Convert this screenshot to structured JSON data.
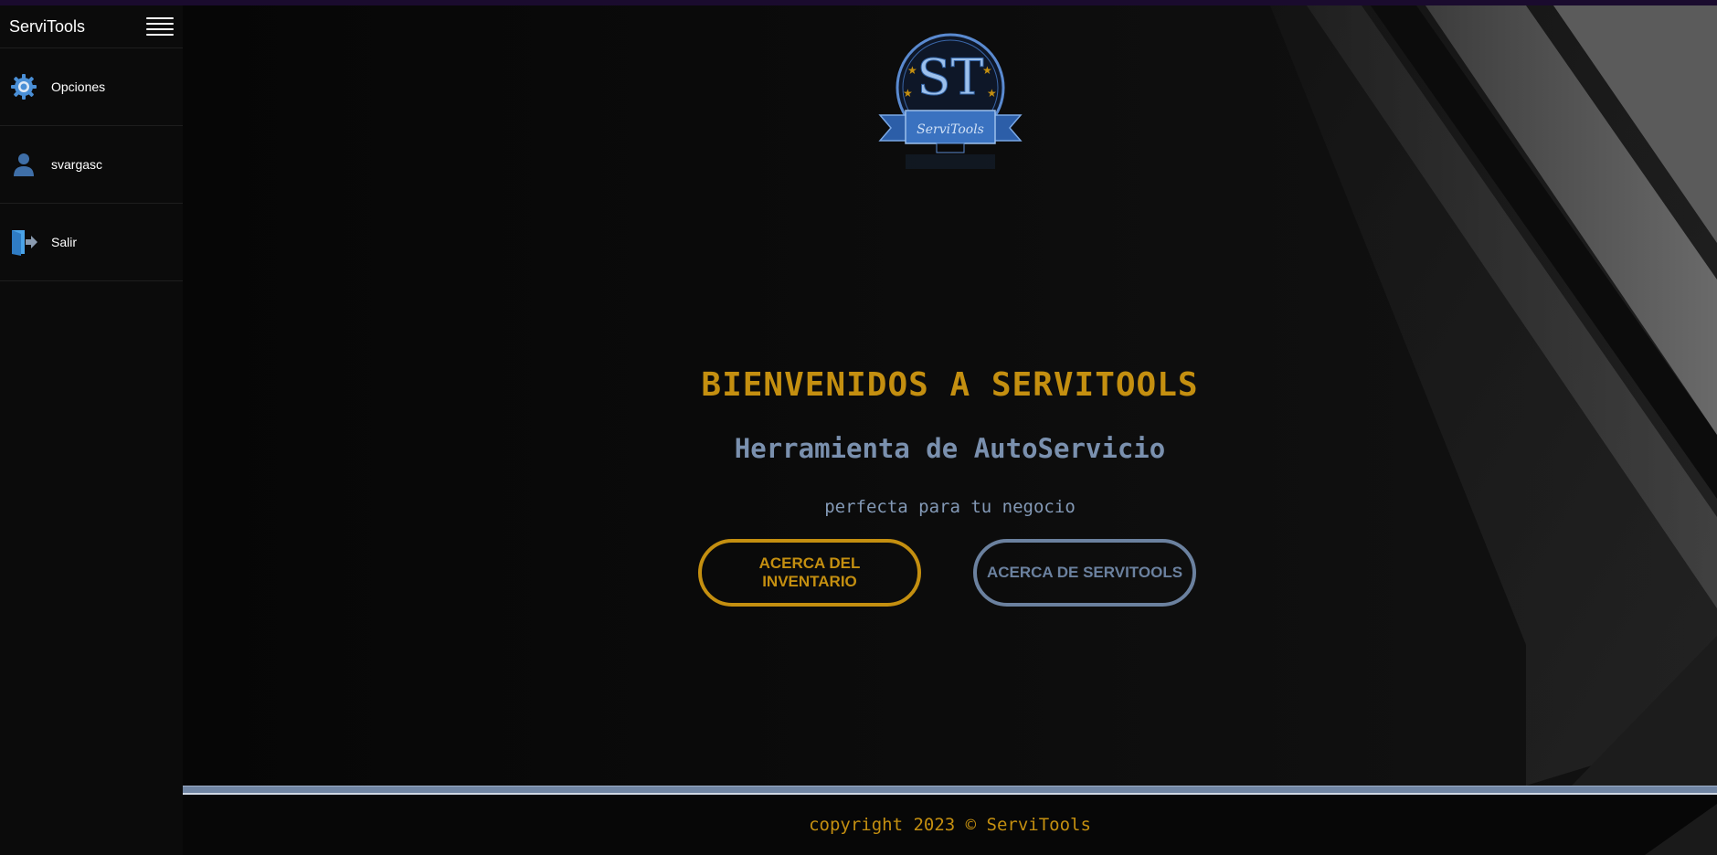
{
  "app": {
    "name": "ServiTools"
  },
  "sidebar": {
    "items": [
      {
        "label": "Opciones",
        "icon": "gear-icon"
      },
      {
        "label": "svargasc",
        "icon": "user-icon"
      },
      {
        "label": "Salir",
        "icon": "logout-icon"
      }
    ]
  },
  "logo": {
    "monogram": "ST",
    "banner_text": "ServiTools"
  },
  "hero": {
    "title": "BIENVENIDOS A SERVITOOLS",
    "subtitle": "Herramienta de AutoServicio",
    "tagline": "perfecta para tu negocio"
  },
  "buttons": {
    "inventory": "ACERCA DEL INVENTARIO",
    "about": "ACERCA DE SERVITOOLS"
  },
  "footer": {
    "text": "copyright 2023 © ServiTools"
  },
  "colors": {
    "gold": "#c48f10",
    "steel_blue": "#6b819f",
    "icon_blue": "#4a90d9",
    "background": "#0a0a0a"
  }
}
